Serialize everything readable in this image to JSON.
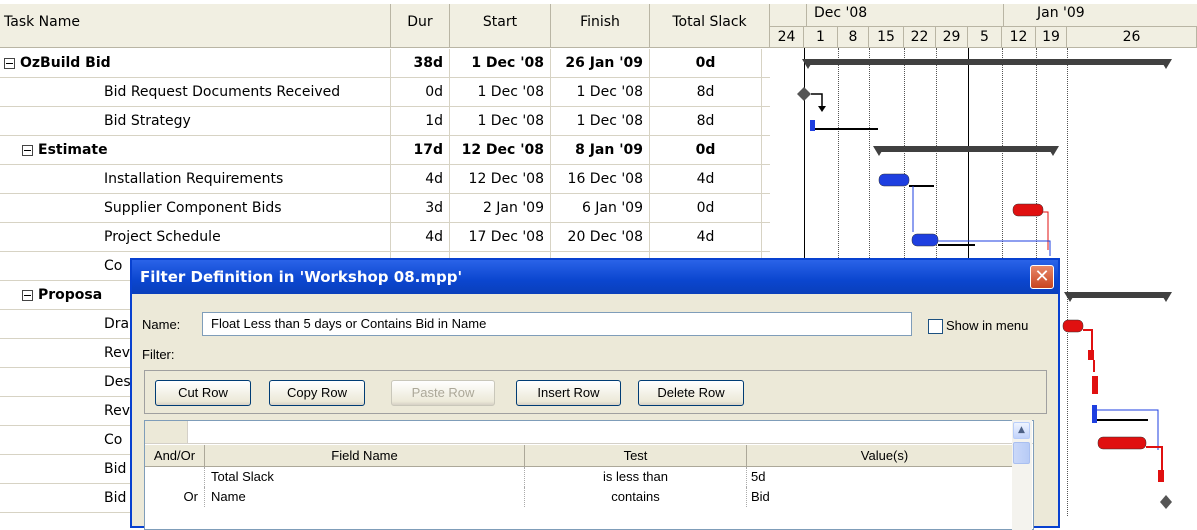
{
  "table": {
    "headers": {
      "name": "Task Name",
      "dur": "Dur",
      "start": "Start",
      "finish": "Finish",
      "slack": "Total Slack"
    },
    "rows": [
      {
        "name": "OzBuild Bid",
        "dur": "38d",
        "start": "1 Dec '08",
        "finish": "26 Jan '09",
        "slack": "0d",
        "summary": true,
        "indent": 0
      },
      {
        "name": "Bid Request Documents Received",
        "dur": "0d",
        "start": "1 Dec '08",
        "finish": "1 Dec '08",
        "slack": "8d",
        "summary": false,
        "indent": 2
      },
      {
        "name": "Bid Strategy",
        "dur": "1d",
        "start": "1 Dec '08",
        "finish": "1 Dec '08",
        "slack": "8d",
        "summary": false,
        "indent": 2
      },
      {
        "name": "Estimate",
        "dur": "17d",
        "start": "12 Dec '08",
        "finish": "8 Jan '09",
        "slack": "0d",
        "summary": true,
        "indent": 1
      },
      {
        "name": "Installation Requirements",
        "dur": "4d",
        "start": "12 Dec '08",
        "finish": "16 Dec '08",
        "slack": "4d",
        "summary": false,
        "indent": 2
      },
      {
        "name": "Supplier Component Bids",
        "dur": "3d",
        "start": "2 Jan '09",
        "finish": "6 Jan '09",
        "slack": "0d",
        "summary": false,
        "indent": 2
      },
      {
        "name": "Project Schedule",
        "dur": "4d",
        "start": "17 Dec '08",
        "finish": "20 Dec '08",
        "slack": "4d",
        "summary": false,
        "indent": 2
      },
      {
        "name": "Co",
        "dur": "",
        "start": "",
        "finish": "",
        "slack": "",
        "summary": false,
        "indent": 2
      },
      {
        "name": "Proposa",
        "dur": "",
        "start": "",
        "finish": "",
        "slack": "",
        "summary": true,
        "indent": 1
      },
      {
        "name": "Dra",
        "dur": "",
        "start": "",
        "finish": "",
        "slack": "",
        "summary": false,
        "indent": 2
      },
      {
        "name": "Rev",
        "dur": "",
        "start": "",
        "finish": "",
        "slack": "",
        "summary": false,
        "indent": 2
      },
      {
        "name": "Des",
        "dur": "",
        "start": "",
        "finish": "",
        "slack": "",
        "summary": false,
        "indent": 2
      },
      {
        "name": "Rev",
        "dur": "",
        "start": "",
        "finish": "",
        "slack": "",
        "summary": false,
        "indent": 2
      },
      {
        "name": "Co",
        "dur": "",
        "start": "",
        "finish": "",
        "slack": "",
        "summary": false,
        "indent": 2
      },
      {
        "name": "Bid",
        "dur": "",
        "start": "",
        "finish": "",
        "slack": "",
        "summary": false,
        "indent": 2
      },
      {
        "name": "Bid",
        "dur": "",
        "start": "",
        "finish": "",
        "slack": "",
        "summary": false,
        "indent": 2
      }
    ]
  },
  "gantt": {
    "months": [
      "Dec '08",
      "Jan '09"
    ],
    "days": [
      "24",
      "1",
      "8",
      "15",
      "22",
      "29",
      "5",
      "12",
      "19",
      "26"
    ],
    "colors": {
      "normal": "#1e3fe0",
      "critical": "#e01010",
      "summary": "#404040"
    }
  },
  "dialog": {
    "title": "Filter Definition in 'Workshop 08.mpp'",
    "name_label": "Name:",
    "name_value": "Float Less than 5 days or Contains Bid in  Name",
    "show_in_menu": "Show in menu",
    "show_in_menu_checked": false,
    "filter_label": "Filter:",
    "buttons": {
      "cut": "Cut Row",
      "copy": "Copy Row",
      "paste": "Paste Row",
      "insert": "Insert Row",
      "delete": "Delete Row"
    },
    "grid_headers": {
      "andor": "And/Or",
      "field": "Field Name",
      "test": "Test",
      "values": "Value(s)"
    },
    "grid_rows": [
      {
        "andor": "",
        "field": "Total Slack",
        "test": "is less than",
        "values": "5d"
      },
      {
        "andor": "Or",
        "field": "Name",
        "test": "contains",
        "values": "Bid"
      }
    ]
  }
}
